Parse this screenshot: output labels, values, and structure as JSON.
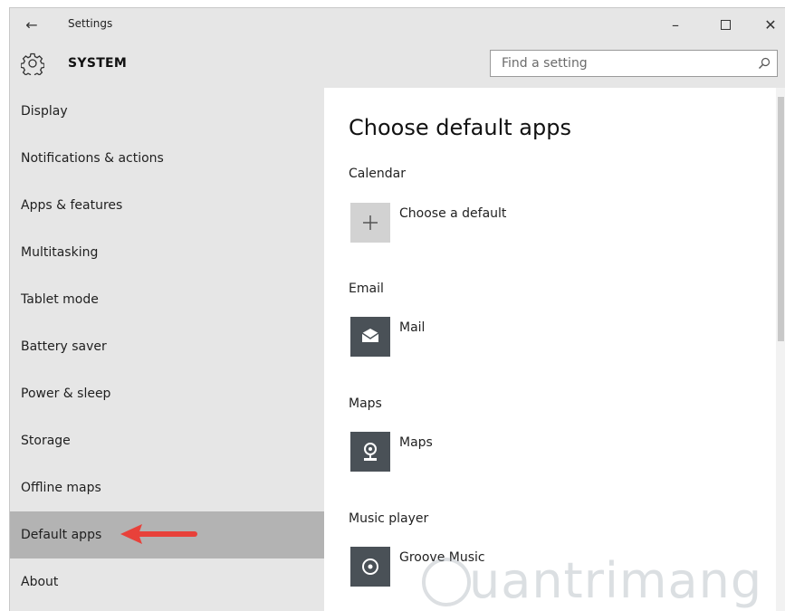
{
  "window": {
    "back_glyph": "←",
    "title": "Settings",
    "minimize_glyph": "–",
    "close_glyph": "✕"
  },
  "header": {
    "icon": "gear-icon",
    "section": "SYSTEM",
    "search_placeholder": "Find a setting",
    "search_icon": "search-icon"
  },
  "sidebar": {
    "items": [
      {
        "label": "Display",
        "selected": false
      },
      {
        "label": "Notifications & actions",
        "selected": false
      },
      {
        "label": "Apps & features",
        "selected": false
      },
      {
        "label": "Multitasking",
        "selected": false
      },
      {
        "label": "Tablet mode",
        "selected": false
      },
      {
        "label": "Battery saver",
        "selected": false
      },
      {
        "label": "Power & sleep",
        "selected": false
      },
      {
        "label": "Storage",
        "selected": false
      },
      {
        "label": "Offline maps",
        "selected": false
      },
      {
        "label": "Default apps",
        "selected": true
      },
      {
        "label": "About",
        "selected": false
      }
    ],
    "annotation_color": "#e8413a"
  },
  "main": {
    "title": "Choose default apps",
    "groups": [
      {
        "label": "Calendar",
        "app": "Choose a default",
        "icon": "plus-icon"
      },
      {
        "label": "Email",
        "app": "Mail",
        "icon": "mail-icon"
      },
      {
        "label": "Maps",
        "app": "Maps",
        "icon": "maps-icon"
      },
      {
        "label": "Music player",
        "app": "Groove Music",
        "icon": "groove-music-icon"
      }
    ]
  },
  "watermark": {
    "text": "uantrimang"
  },
  "colors": {
    "chrome": "#e6e6e6",
    "selected": "#b3b3b3",
    "tile": "#4a5157",
    "add_tile": "#d2d2d2"
  }
}
